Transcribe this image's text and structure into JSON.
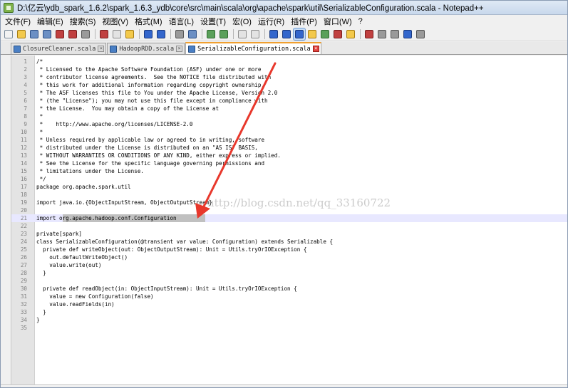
{
  "window": {
    "title": "D:\\亿云\\ydb_spark_1.6.2\\spark_1.6.3_ydb\\core\\src\\main\\scala\\org\\apache\\spark\\util\\SerializableConfiguration.scala - Notepad++"
  },
  "menu": [
    {
      "label": "文件(F)"
    },
    {
      "label": "编辑(E)"
    },
    {
      "label": "搜索(S)"
    },
    {
      "label": "视图(V)"
    },
    {
      "label": "格式(M)"
    },
    {
      "label": "语言(L)"
    },
    {
      "label": "设置(T)"
    },
    {
      "label": "宏(O)"
    },
    {
      "label": "运行(R)"
    },
    {
      "label": "插件(P)"
    },
    {
      "label": "窗口(W)"
    },
    {
      "label": "?"
    }
  ],
  "toolbar_icons": [
    "new-file-icon",
    "open-file-icon",
    "save-icon",
    "save-all-icon",
    "close-icon",
    "close-all-icon",
    "print-icon",
    "cut-icon",
    "copy-icon",
    "paste-icon",
    "undo-icon",
    "redo-icon",
    "find-icon",
    "replace-icon",
    "zoom-in-icon",
    "zoom-out-icon",
    "sync-vertical-icon",
    "sync-horizontal-icon",
    "word-wrap-icon",
    "show-all-chars-icon",
    "indent-guide-icon",
    "user-language-icon",
    "doc-map-icon",
    "function-list-icon",
    "folder-workspace-icon",
    "macro-record-icon",
    "macro-stop-icon",
    "macro-play-icon",
    "macro-run-multiple-icon",
    "macro-save-icon"
  ],
  "tabs": [
    {
      "label": "ClosureCleaner.scala",
      "active": false
    },
    {
      "label": "HadoopRDD.scala",
      "active": false
    },
    {
      "label": "SerializableConfiguration.scala",
      "active": true
    }
  ],
  "editor": {
    "current_line": 21,
    "selection_text": "org.apache.hadoop.conf.Configuration",
    "lines": [
      "/*",
      " * Licensed to the Apache Software Foundation (ASF) under one or more",
      " * contributor license agreements.  See the NOTICE file distributed with",
      " * this work for additional information regarding copyright ownership.",
      " * The ASF licenses this file to You under the Apache License, Version 2.0",
      " * (the \"License\"); you may not use this file except in compliance with",
      " * the License.  You may obtain a copy of the License at",
      " *",
      " *    http://www.apache.org/licenses/LICENSE-2.0",
      " *",
      " * Unless required by applicable law or agreed to in writing, software",
      " * distributed under the License is distributed on an \"AS IS\" BASIS,",
      " * WITHOUT WARRANTIES OR CONDITIONS OF ANY KIND, either express or implied.",
      " * See the License for the specific language governing permissions and",
      " * limitations under the License.",
      " */",
      "package org.apache.spark.util",
      "",
      "import java.io.{ObjectInputStream, ObjectOutputStream}",
      "",
      "import org.apache.hadoop.conf.Configuration",
      "",
      "private[spark]",
      "class SerializableConfiguration(@transient var value: Configuration) extends Serializable {",
      "  private def writeObject(out: ObjectOutputStream): Unit = Utils.tryOrIOException {",
      "    out.defaultWriteObject()",
      "    value.write(out)",
      "  }",
      "",
      "  private def readObject(in: ObjectInputStream): Unit = Utils.tryOrIOException {",
      "    value = new Configuration(false)",
      "    value.readFields(in)",
      "  }",
      "}",
      ""
    ]
  },
  "watermark": "http://blog.csdn.net/qq_33160722",
  "colors": {
    "current_line_bg": "#e8e8ff",
    "selection_bg": "#c0c0c0",
    "annotation_arrow": "#e8382c",
    "gutter_bg": "#e4e4e4",
    "active_tab_accent": "#f0a030"
  }
}
